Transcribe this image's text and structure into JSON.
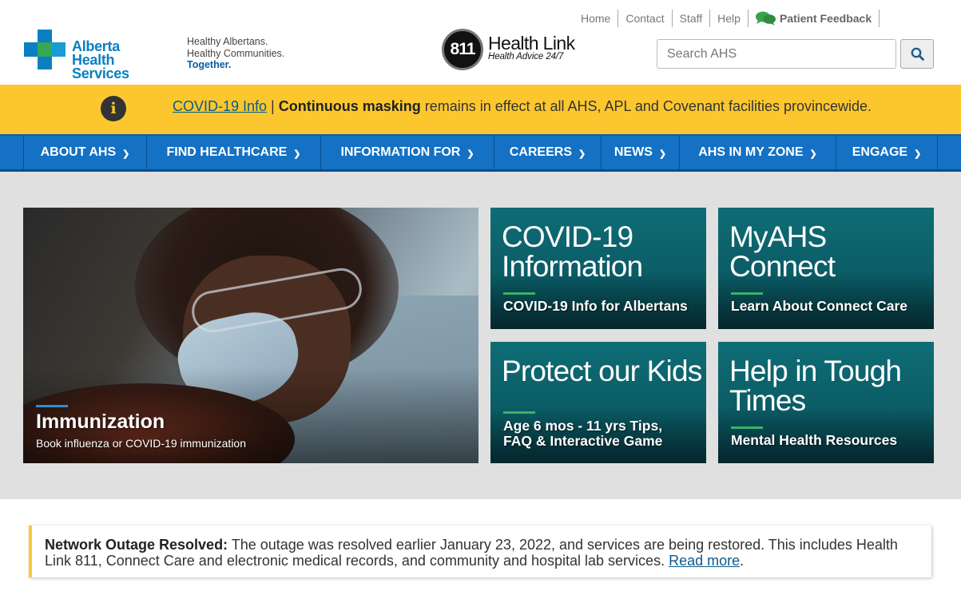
{
  "header": {
    "logo_text_line1": "Alberta Health",
    "logo_text_line2": "Services",
    "tagline_line1": "Healthy Albertans.",
    "tagline_line2": "Healthy Communities.",
    "tagline_line3": "Together.",
    "healthlink_number": "811",
    "healthlink_title": "Health Link",
    "healthlink_sub": "Health Advice 24/7",
    "utility_links": [
      "Home",
      "Contact",
      "Staff",
      "Help"
    ],
    "feedback_label": "Patient Feedback",
    "search_placeholder": "Search AHS"
  },
  "alert": {
    "link_text": "COVID-19 Info",
    "separator": " | ",
    "bold_text": "Continuous masking",
    "rest_text": " remains in effect at all AHS, APL and Covenant facilities provincewide."
  },
  "nav": {
    "items": [
      "ABOUT AHS",
      "FIND HEALTHCARE",
      "INFORMATION FOR",
      "CAREERS",
      "NEWS",
      "AHS IN MY ZONE",
      "ENGAGE"
    ]
  },
  "feature": {
    "title": "Immunization",
    "subtitle": "Book influenza or COVID-19 immunization"
  },
  "tiles": [
    {
      "heading_line1": "COVID-19",
      "heading_line2": "Information",
      "caption": "COVID-19 Info for Albertans"
    },
    {
      "heading_line1": "MyAHS",
      "heading_line2": "Connect",
      "caption": "Learn About Connect Care"
    },
    {
      "heading_line1": "Protect our Kids",
      "heading_line2": "",
      "caption_line1": "Age 6 mos - 11 yrs Tips,",
      "caption_line2": "FAQ & Interactive Game"
    },
    {
      "heading_line1": "Help in Tough",
      "heading_line2": "Times",
      "caption": "Mental Health Resources"
    }
  ],
  "notice": {
    "bold": "Network Outage Resolved:",
    "text": " The outage was resolved earlier January 23, 2022, and services are being restored. This includes Health Link 811, Connect Care and electronic medical records, and community and hospital lab services. ",
    "link": "Read more",
    "end": "."
  },
  "colors": {
    "brand_blue": "#1471c4",
    "alert_yellow": "#fcc72e",
    "tile_teal": "#0b5c66",
    "accent_green": "#3ab26a"
  }
}
